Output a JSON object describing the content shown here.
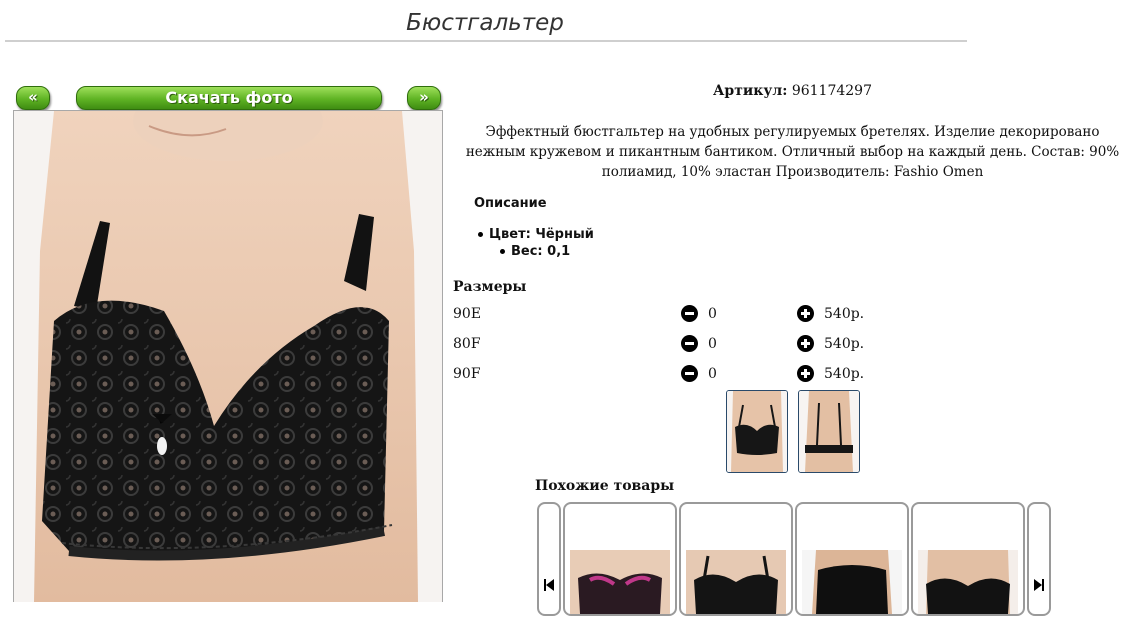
{
  "page": {
    "title": "Бюстгальтер"
  },
  "gallery": {
    "prev_label": "«",
    "next_label": "»",
    "download_label": "Скачать фото"
  },
  "product": {
    "article_label": "Артикул:",
    "article_value": "961174297",
    "description": "Эффектный бюстгальтер на удобных регулируемых бретелях. Изделие декорировано нежным кружевом и пикантным бантиком. Отличный выбор на каждый день. Состав: 90% полиамид, 10% эластан Производитель: Fashio Omen"
  },
  "specs": {
    "heading": "Описание",
    "color": "Цвет: Чёрный",
    "weight": "Вес: 0,1"
  },
  "sizes": {
    "heading": "Размеры",
    "rows": [
      {
        "size": "90E",
        "qty": "0",
        "price": "540р."
      },
      {
        "size": "80F",
        "qty": "0",
        "price": "540р."
      },
      {
        "size": "90F",
        "qty": "0",
        "price": "540р."
      }
    ]
  },
  "similar": {
    "heading": "Похожие товары"
  },
  "colors": {
    "button_green": "#5fb324",
    "bra_black": "#141414",
    "skin": "#e9c8ad"
  },
  "icons": [
    "minus-circle-icon",
    "plus-circle-icon",
    "skip-back-icon",
    "skip-forward-icon"
  ]
}
